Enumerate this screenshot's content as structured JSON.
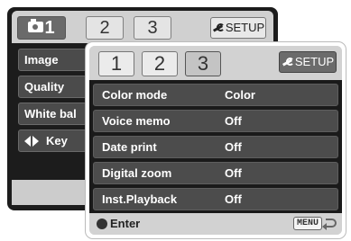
{
  "back_menu": {
    "tabs": [
      {
        "label": "1",
        "icon": "camera-icon"
      },
      {
        "label": "2"
      },
      {
        "label": "3"
      }
    ],
    "setup_label": "SETUP",
    "items": [
      "Image",
      "Quality",
      "White bal"
    ],
    "key_label": "Key"
  },
  "front_menu": {
    "tabs": [
      {
        "label": "1"
      },
      {
        "label": "2"
      },
      {
        "label": "3"
      }
    ],
    "setup_label": "SETUP",
    "rows": [
      {
        "label": "Color mode",
        "value": "Color"
      },
      {
        "label": "Voice memo",
        "value": "Off"
      },
      {
        "label": "Date print",
        "value": "Off"
      },
      {
        "label": "Digital zoom",
        "value": "Off"
      },
      {
        "label": "Inst.Playback",
        "value": "Off"
      }
    ],
    "footer": {
      "enter_label": "Enter",
      "menu_label": "MENU"
    }
  }
}
